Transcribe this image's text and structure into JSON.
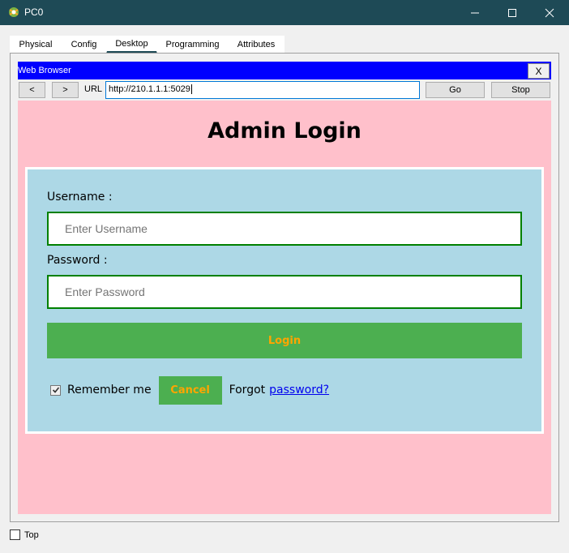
{
  "window": {
    "title": "PC0",
    "minimize_icon": "minimize-icon",
    "maximize_icon": "maximize-icon",
    "close_icon": "close-icon",
    "accent_color": "#1e4a56"
  },
  "tabs": [
    {
      "label": "Physical",
      "active": false
    },
    {
      "label": "Config",
      "active": false
    },
    {
      "label": "Desktop",
      "active": true
    },
    {
      "label": "Programming",
      "active": false
    },
    {
      "label": "Attributes",
      "active": false
    }
  ],
  "browser": {
    "title": "Web Browser",
    "close_label": "X",
    "back_label": "<",
    "forward_label": ">",
    "url_label": "URL",
    "url_value": "http://210.1.1.1:5029",
    "go_label": "Go",
    "stop_label": "Stop",
    "header_color": "#0000ff"
  },
  "page": {
    "title": "Admin Login",
    "background": "#ffc0cb",
    "form_background": "#add8e6",
    "username_label": "Username :",
    "username_placeholder": "Enter Username",
    "password_label": "Password :",
    "password_placeholder": "Enter Password",
    "login_label": "Login",
    "remember_label": "Remember me",
    "remember_checked": true,
    "cancel_label": "Cancel",
    "forgot_text": "Forgot",
    "forgot_link": "password?",
    "button_color": "#4caf50",
    "button_text_color": "#ffa500"
  },
  "footer": {
    "top_label": "Top",
    "top_checked": false
  }
}
